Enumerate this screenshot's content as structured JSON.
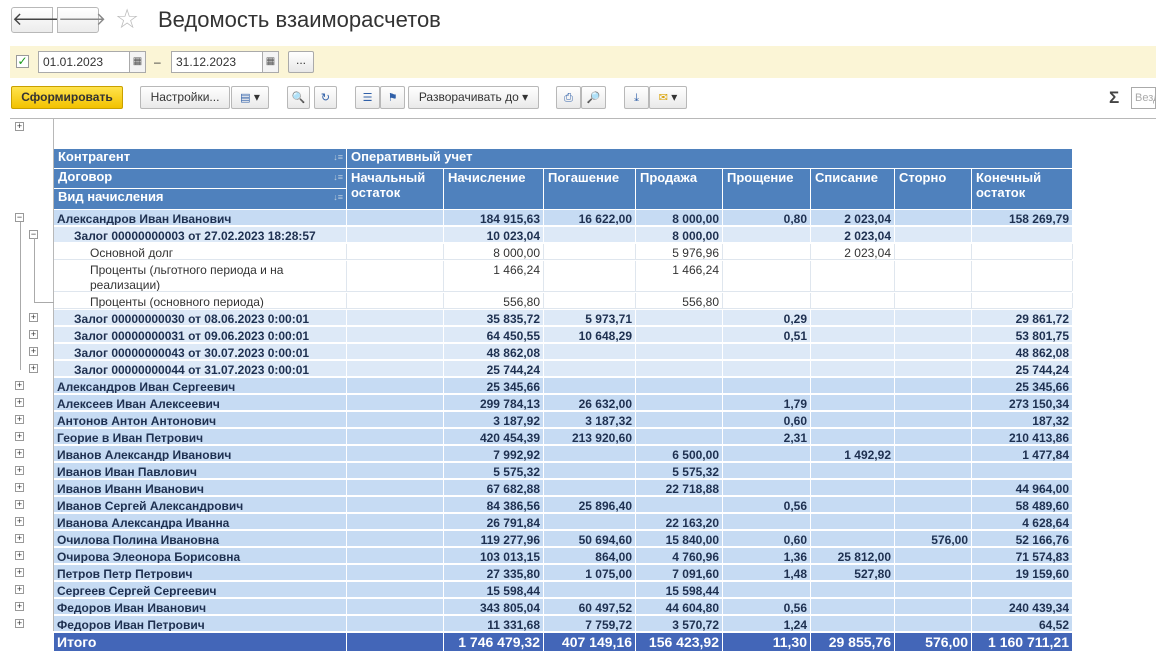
{
  "window": {
    "title": "Ведомость взаиморасчетов",
    "back_icon": "arrow-left-icon",
    "forward_icon": "arrow-right-icon",
    "favorite_icon": "star-icon"
  },
  "period": {
    "enabled": true,
    "date_from": "01.01.2023",
    "separator": "–",
    "date_to": "31.12.2023",
    "more_label": "..."
  },
  "toolbar": {
    "generate_label": "Сформировать",
    "settings_label": "Настройки...",
    "expand_to_label": "Разворачивать до",
    "sigma": "Σ",
    "search_placeholder": "Везде"
  },
  "headers": {
    "counterparty": "Контрагент",
    "contract": "Договор",
    "accrual_type": "Вид начисления",
    "operational": "Оперативный учет",
    "columns": [
      "Начальный остаток",
      "Начисление",
      "Погашение",
      "Продажа",
      "Прощение",
      "Списание",
      "Сторно",
      "Конечный остаток"
    ]
  },
  "rows": [
    {
      "level": 0,
      "name": "Александров Иван Иванович",
      "vals": [
        "",
        "184 915,63",
        "16 622,00",
        "8 000,00",
        "0,80",
        "2 023,04",
        "",
        "158 269,79"
      ]
    },
    {
      "level": 1,
      "name": "Залог 00000000003 от 27.02.2023 18:28:57",
      "vals": [
        "",
        "10 023,04",
        "",
        "8 000,00",
        "",
        "2 023,04",
        "",
        ""
      ]
    },
    {
      "level": 2,
      "name": "Основной долг",
      "vals": [
        "",
        "8 000,00",
        "",
        "5 976,96",
        "",
        "2 023,04",
        "",
        ""
      ]
    },
    {
      "level": 2,
      "name": "Проценты (льготного периода и на реализации)",
      "vals": [
        "",
        "1 466,24",
        "",
        "1 466,24",
        "",
        "",
        "",
        ""
      ]
    },
    {
      "level": 2,
      "name": "Проценты (основного периода)",
      "vals": [
        "",
        "556,80",
        "",
        "556,80",
        "",
        "",
        "",
        ""
      ]
    },
    {
      "level": 1,
      "name": "Залог 00000000030 от 08.06.2023 0:00:01",
      "vals": [
        "",
        "35 835,72",
        "5 973,71",
        "",
        "0,29",
        "",
        "",
        "29 861,72"
      ]
    },
    {
      "level": 1,
      "name": "Залог 00000000031 от 09.06.2023 0:00:01",
      "vals": [
        "",
        "64 450,55",
        "10 648,29",
        "",
        "0,51",
        "",
        "",
        "53 801,75"
      ]
    },
    {
      "level": 1,
      "name": "Залог 00000000043 от 30.07.2023 0:00:01",
      "vals": [
        "",
        "48 862,08",
        "",
        "",
        "",
        "",
        "",
        "48 862,08"
      ]
    },
    {
      "level": 1,
      "name": "Залог 00000000044 от 31.07.2023 0:00:01",
      "vals": [
        "",
        "25 744,24",
        "",
        "",
        "",
        "",
        "",
        "25 744,24"
      ]
    },
    {
      "level": 0,
      "name": "Александров Иван Сергеевич",
      "vals": [
        "",
        "25 345,66",
        "",
        "",
        "",
        "",
        "",
        "25 345,66"
      ]
    },
    {
      "level": 0,
      "name": "Алексеев Иван Алексеевич",
      "vals": [
        "",
        "299 784,13",
        "26 632,00",
        "",
        "1,79",
        "",
        "",
        "273 150,34"
      ]
    },
    {
      "level": 0,
      "name": "Антонов Антон Антонович",
      "vals": [
        "",
        "3 187,92",
        "3 187,32",
        "",
        "0,60",
        "",
        "",
        "187,32"
      ]
    },
    {
      "level": 0,
      "name": "Георие в Иван Петрович",
      "vals": [
        "",
        "420 454,39",
        "213 920,60",
        "",
        "2,31",
        "",
        "",
        "210 413,86"
      ]
    },
    {
      "level": 0,
      "name": "Иванов Александр Иванович",
      "vals": [
        "",
        "7 992,92",
        "",
        "6 500,00",
        "",
        "1 492,92",
        "",
        "1 477,84"
      ]
    },
    {
      "level": 0,
      "name": "Иванов Иван Павлович",
      "vals": [
        "",
        "5 575,32",
        "",
        "5 575,32",
        "",
        "",
        "",
        ""
      ]
    },
    {
      "level": 0,
      "name": "Иванов Иванн Иванович",
      "vals": [
        "",
        "67 682,88",
        "",
        "22 718,88",
        "",
        "",
        "",
        "44 964,00"
      ]
    },
    {
      "level": 0,
      "name": "Иванов Сергей Александрович",
      "vals": [
        "",
        "84 386,56",
        "25 896,40",
        "",
        "0,56",
        "",
        "",
        "58 489,60"
      ]
    },
    {
      "level": 0,
      "name": "Иванова Александра Иванна",
      "vals": [
        "",
        "26 791,84",
        "",
        "22 163,20",
        "",
        "",
        "",
        "4 628,64"
      ]
    },
    {
      "level": 0,
      "name": "Очилова Полина Ивановна",
      "vals": [
        "",
        "119 277,96",
        "50 694,60",
        "15 840,00",
        "0,60",
        "",
        "576,00",
        "52 166,76"
      ]
    },
    {
      "level": 0,
      "name": "Очирова Элеонора Борисовна",
      "vals": [
        "",
        "103 013,15",
        "864,00",
        "4 760,96",
        "1,36",
        "25 812,00",
        "",
        "71 574,83"
      ]
    },
    {
      "level": 0,
      "name": "Петров Петр Петрович",
      "vals": [
        "",
        "27 335,80",
        "1 075,00",
        "7 091,60",
        "1,48",
        "527,80",
        "",
        "19 159,60"
      ]
    },
    {
      "level": 0,
      "name": "Сергеев Сергей Сергеевич",
      "vals": [
        "",
        "15 598,44",
        "",
        "15 598,44",
        "",
        "",
        "",
        ""
      ]
    },
    {
      "level": 0,
      "name": "Федоров Иван Иванович",
      "vals": [
        "",
        "343 805,04",
        "60 497,52",
        "44 604,80",
        "0,56",
        "",
        "",
        "240 439,34"
      ]
    },
    {
      "level": 0,
      "name": "Федоров Иван Петрович",
      "vals": [
        "",
        "11 331,68",
        "7 759,72",
        "3 570,72",
        "1,24",
        "",
        "",
        "64,52"
      ]
    }
  ],
  "total": {
    "name": "Итого",
    "vals": [
      "",
      "1 746 479,32",
      "407 149,16",
      "156 423,92",
      "11,30",
      "29 855,76",
      "576,00",
      "1 160 711,21"
    ]
  }
}
